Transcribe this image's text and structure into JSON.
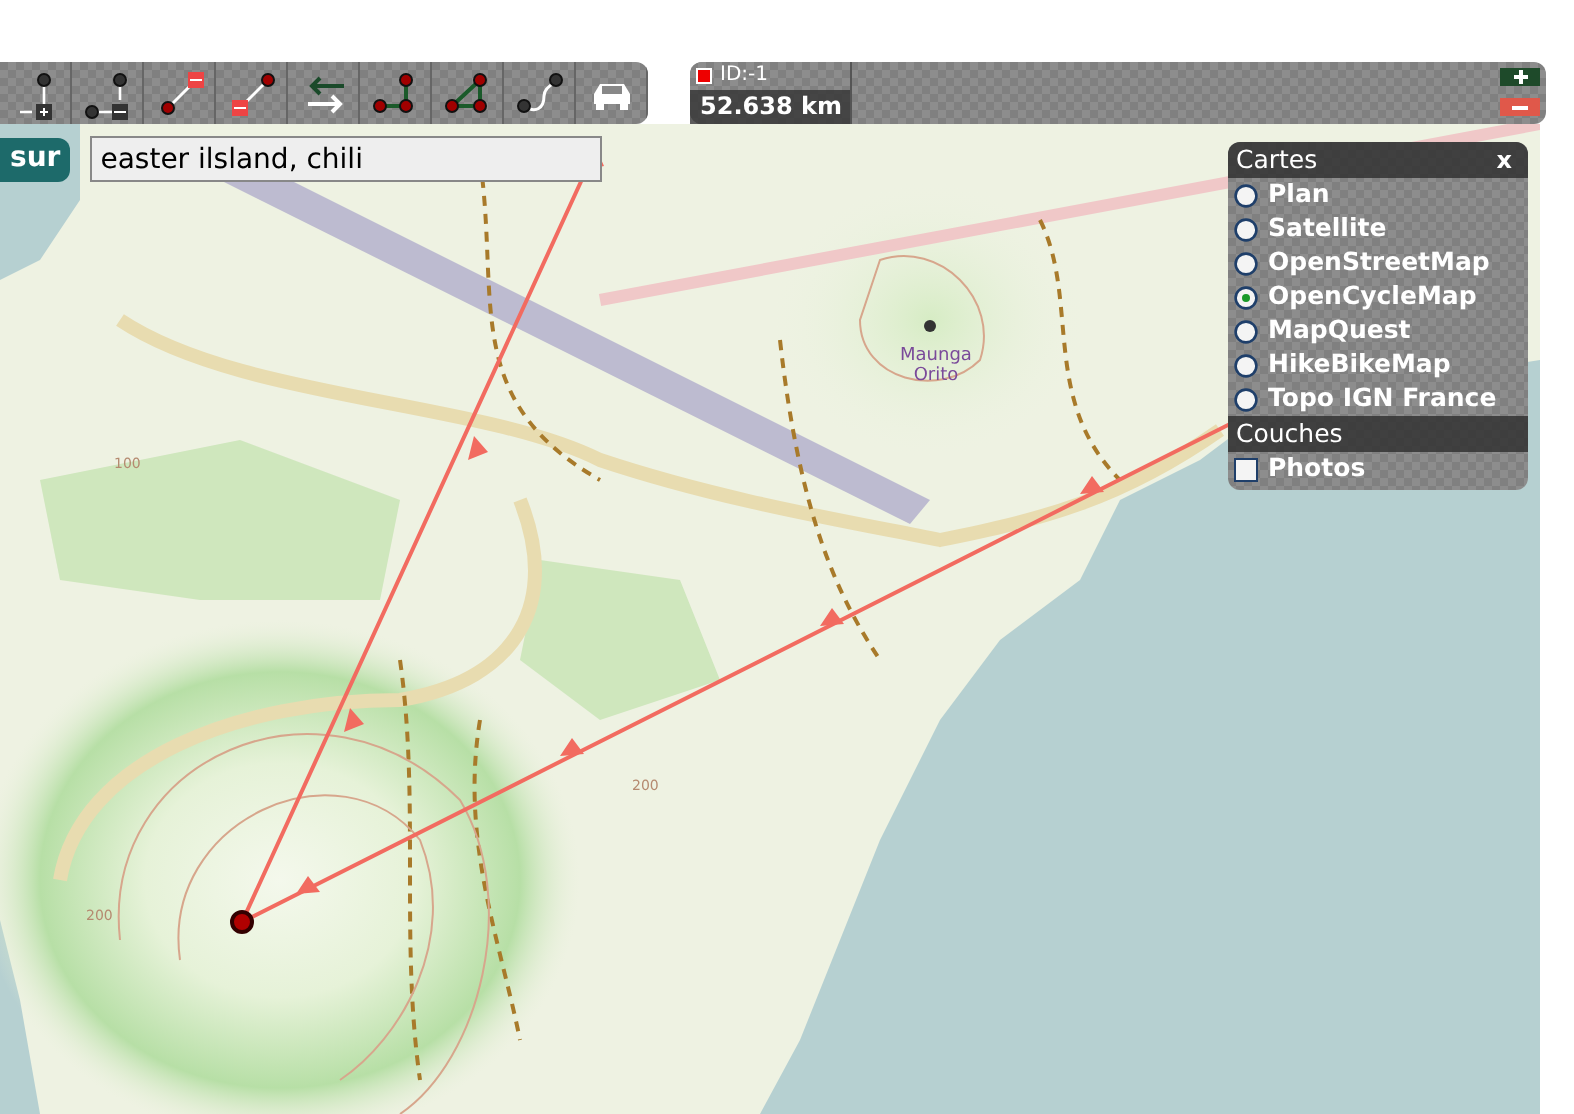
{
  "search": {
    "button": "sur",
    "value": "easter ilsland, chili"
  },
  "route_info": {
    "id": "ID:-1",
    "distance": "52.638 km"
  },
  "map_labels": [
    {
      "text": "Maunga Orito",
      "kind": "peak"
    },
    {
      "text": "100",
      "kind": "contour"
    },
    {
      "text": "200",
      "kind": "contour"
    },
    {
      "text": "200",
      "kind": "contour"
    }
  ],
  "layers_panel": {
    "title": "Cartes",
    "close": "x",
    "base_layers": [
      {
        "label": "Plan",
        "selected": false
      },
      {
        "label": "Satellite",
        "selected": false
      },
      {
        "label": "OpenStreetMap",
        "selected": false
      },
      {
        "label": "OpenCycleMap",
        "selected": true
      },
      {
        "label": "MapQuest",
        "selected": false
      },
      {
        "label": "HikeBikeMap",
        "selected": false
      },
      {
        "label": "Topo IGN France",
        "selected": false
      }
    ],
    "overlays_title": "Couches",
    "overlays": [
      {
        "label": "Photos",
        "checked": false
      }
    ]
  }
}
